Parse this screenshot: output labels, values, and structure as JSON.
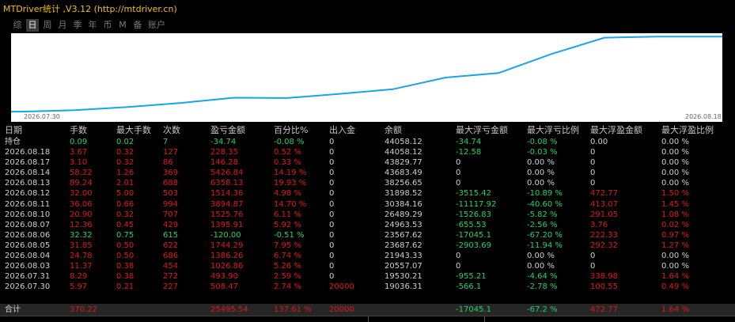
{
  "app": {
    "title": "MTDriver统计 ,V3.12 (http://mtdriver.cn)"
  },
  "tabs": [
    {
      "label": "综",
      "active": false,
      "wide": false
    },
    {
      "label": "日",
      "active": true,
      "wide": false
    },
    {
      "label": "周",
      "active": false,
      "wide": false
    },
    {
      "label": "月",
      "active": false,
      "wide": false
    },
    {
      "label": "季",
      "active": false,
      "wide": false
    },
    {
      "label": "年",
      "active": false,
      "wide": false
    },
    {
      "label": "币",
      "active": false,
      "wide": false
    },
    {
      "label": "M",
      "active": false,
      "wide": false
    },
    {
      "label": "备",
      "active": false,
      "wide": false
    },
    {
      "label": "账户",
      "active": false,
      "wide": true
    }
  ],
  "chart_data": {
    "type": "line",
    "x_start_label": "2026.07.30",
    "x_end_label": "2026.08.18",
    "x": [
      "2026.07.30",
      "2026.07.31",
      "2026.08.03",
      "2026.08.04",
      "2026.08.05",
      "2026.08.06",
      "2026.08.07",
      "2026.08.10",
      "2026.08.11",
      "2026.08.12",
      "2026.08.13",
      "2026.08.14",
      "2026.08.17",
      "2026.08.18"
    ],
    "values": [
      19036.31,
      19530.21,
      20557.07,
      21943.33,
      23687.62,
      23567.62,
      24963.53,
      26489.29,
      30384.16,
      31898.52,
      38256.65,
      43683.49,
      44058.12,
      44058.12
    ],
    "ylim": [
      18800,
      44100
    ],
    "line_color": "#1aa3e8",
    "background": "#ffffff"
  },
  "table": {
    "headers": [
      "日期",
      "手数",
      "最大手数",
      "次数",
      "盈亏金额",
      "百分比%",
      "出入金",
      "余额",
      "最大浮亏金额",
      "最大浮亏比例",
      "最大浮盈金额",
      "最大浮盈比例"
    ],
    "rows": [
      {
        "cells": [
          "持仓",
          "0.09",
          "0.02",
          "7",
          "-34.74",
          "-0.08 %",
          "0",
          "44058.12",
          "-34.74",
          "-0.08 %",
          "0.00",
          "0.00 %"
        ],
        "colors": [
          "w",
          "g",
          "g",
          "g",
          "g",
          "g",
          "w",
          "w",
          "g",
          "g",
          "w",
          "w"
        ]
      },
      {
        "cells": [
          "2026.08.18",
          "3.67",
          "0.32",
          "127",
          "228.35",
          "0.52 %",
          "0",
          "44058.12",
          "-12.58",
          "-0.03 %",
          "0",
          "0.00 %"
        ],
        "colors": [
          "w",
          "r",
          "r",
          "r",
          "r",
          "r",
          "w",
          "w",
          "g",
          "g",
          "w",
          "w"
        ]
      },
      {
        "cells": [
          "2026.08.17",
          "3.10",
          "0.32",
          "86",
          "146.28",
          "0.33 %",
          "0",
          "43829.77",
          "0",
          "0.00 %",
          "0",
          "0.00 %"
        ],
        "colors": [
          "w",
          "r",
          "r",
          "r",
          "r",
          "r",
          "w",
          "w",
          "w",
          "w",
          "w",
          "w"
        ]
      },
      {
        "cells": [
          "2026.08.14",
          "58.22",
          "1.26",
          "369",
          "5426.84",
          "14.19 %",
          "0",
          "43683.49",
          "0",
          "0.00 %",
          "0",
          "0.00 %"
        ],
        "colors": [
          "w",
          "r",
          "r",
          "r",
          "r",
          "r",
          "w",
          "w",
          "w",
          "w",
          "w",
          "w"
        ]
      },
      {
        "cells": [
          "2026.08.13",
          "89.24",
          "2.01",
          "688",
          "6358.13",
          "19.93 %",
          "0",
          "38256.65",
          "0",
          "0.00 %",
          "0",
          "0.00 %"
        ],
        "colors": [
          "w",
          "r",
          "r",
          "r",
          "r",
          "r",
          "w",
          "w",
          "w",
          "w",
          "w",
          "w"
        ]
      },
      {
        "cells": [
          "2026.08.12",
          "32.00",
          "5.00",
          "503",
          "1514.36",
          "4.98 %",
          "0",
          "31898.52",
          "-3515.42",
          "-10.89 %",
          "472.77",
          "1.50 %"
        ],
        "colors": [
          "w",
          "r",
          "r",
          "r",
          "r",
          "r",
          "w",
          "w",
          "g",
          "g",
          "r",
          "r"
        ]
      },
      {
        "cells": [
          "2026.08.11",
          "36.06",
          "0.66",
          "994",
          "3894.87",
          "14.70 %",
          "0",
          "30384.16",
          "-11117.92",
          "-40.60 %",
          "413.07",
          "1.45 %"
        ],
        "colors": [
          "w",
          "r",
          "r",
          "r",
          "r",
          "r",
          "w",
          "w",
          "g",
          "g",
          "r",
          "r"
        ]
      },
      {
        "cells": [
          "2026.08.10",
          "20.90",
          "0.32",
          "707",
          "1525.76",
          "6.11 %",
          "0",
          "26489.29",
          "-1526.83",
          "-5.82 %",
          "291.05",
          "1.08 %"
        ],
        "colors": [
          "w",
          "r",
          "r",
          "r",
          "r",
          "r",
          "w",
          "w",
          "g",
          "g",
          "r",
          "r"
        ]
      },
      {
        "cells": [
          "2026.08.07",
          "12.36",
          "0.45",
          "429",
          "1395.91",
          "5.92 %",
          "0",
          "24963.53",
          "-655.53",
          "-2.56 %",
          "3.76",
          "0.02 %"
        ],
        "colors": [
          "w",
          "r",
          "r",
          "r",
          "r",
          "r",
          "w",
          "w",
          "g",
          "g",
          "r",
          "r"
        ]
      },
      {
        "cells": [
          "2026.08.06",
          "32.32",
          "0.75",
          "615",
          "-120.00",
          "-0.51 %",
          "0",
          "23567.62",
          "-17045.1",
          "-67.20 %",
          "222.33",
          "0.97 %"
        ],
        "colors": [
          "w",
          "g",
          "g",
          "g",
          "g",
          "g",
          "w",
          "w",
          "g",
          "g",
          "r",
          "r"
        ]
      },
      {
        "cells": [
          "2026.08.05",
          "31.85",
          "0.50",
          "622",
          "1744.29",
          "7.95 %",
          "0",
          "23687.62",
          "-2903.69",
          "-11.94 %",
          "292.32",
          "1.27 %"
        ],
        "colors": [
          "w",
          "r",
          "r",
          "r",
          "r",
          "r",
          "w",
          "w",
          "g",
          "g",
          "r",
          "r"
        ]
      },
      {
        "cells": [
          "2026.08.04",
          "24.78",
          "0.50",
          "686",
          "1386.26",
          "6.74 %",
          "0",
          "21943.33",
          "0",
          "0.00 %",
          "0",
          "0.00 %"
        ],
        "colors": [
          "w",
          "r",
          "r",
          "r",
          "r",
          "r",
          "w",
          "w",
          "w",
          "w",
          "w",
          "w"
        ]
      },
      {
        "cells": [
          "2026.08.03",
          "11.37",
          "0.38",
          "454",
          "1026.86",
          "5.26 %",
          "0",
          "20557.07",
          "0",
          "0.00 %",
          "0",
          "0.00 %"
        ],
        "colors": [
          "w",
          "r",
          "r",
          "r",
          "r",
          "r",
          "w",
          "w",
          "w",
          "w",
          "w",
          "w"
        ]
      },
      {
        "cells": [
          "2026.07.31",
          "8.29",
          "0.38",
          "272",
          "493.90",
          "2.59 %",
          "0",
          "19530.21",
          "-955.21",
          "-4.64 %",
          "338.98",
          "1.64 %"
        ],
        "colors": [
          "w",
          "r",
          "r",
          "r",
          "r",
          "r",
          "w",
          "w",
          "g",
          "g",
          "r",
          "r"
        ]
      },
      {
        "cells": [
          "2026.07.30",
          "5.97",
          "0.21",
          "227",
          "508.47",
          "2.74 %",
          "20000",
          "19036.31",
          "-566.1",
          "-2.78 %",
          "100.55",
          "0.49 %"
        ],
        "colors": [
          "w",
          "r",
          "r",
          "r",
          "r",
          "r",
          "r",
          "w",
          "g",
          "g",
          "r",
          "r"
        ]
      }
    ],
    "total": {
      "cells": [
        "合计",
        "370.22",
        "",
        "",
        "25495.54",
        "137.61 %",
        "20000",
        "",
        "-17045.1",
        "-67.2 %",
        "472.77",
        "1.64 %"
      ],
      "colors": [
        "w",
        "r",
        "w",
        "w",
        "r",
        "r",
        "r",
        "w",
        "g",
        "g",
        "r",
        "r"
      ]
    }
  },
  "colors": {
    "positive": "#e01818",
    "negative": "#22d36a",
    "neutral": "#d0d0d0",
    "title": "#f2c200"
  }
}
